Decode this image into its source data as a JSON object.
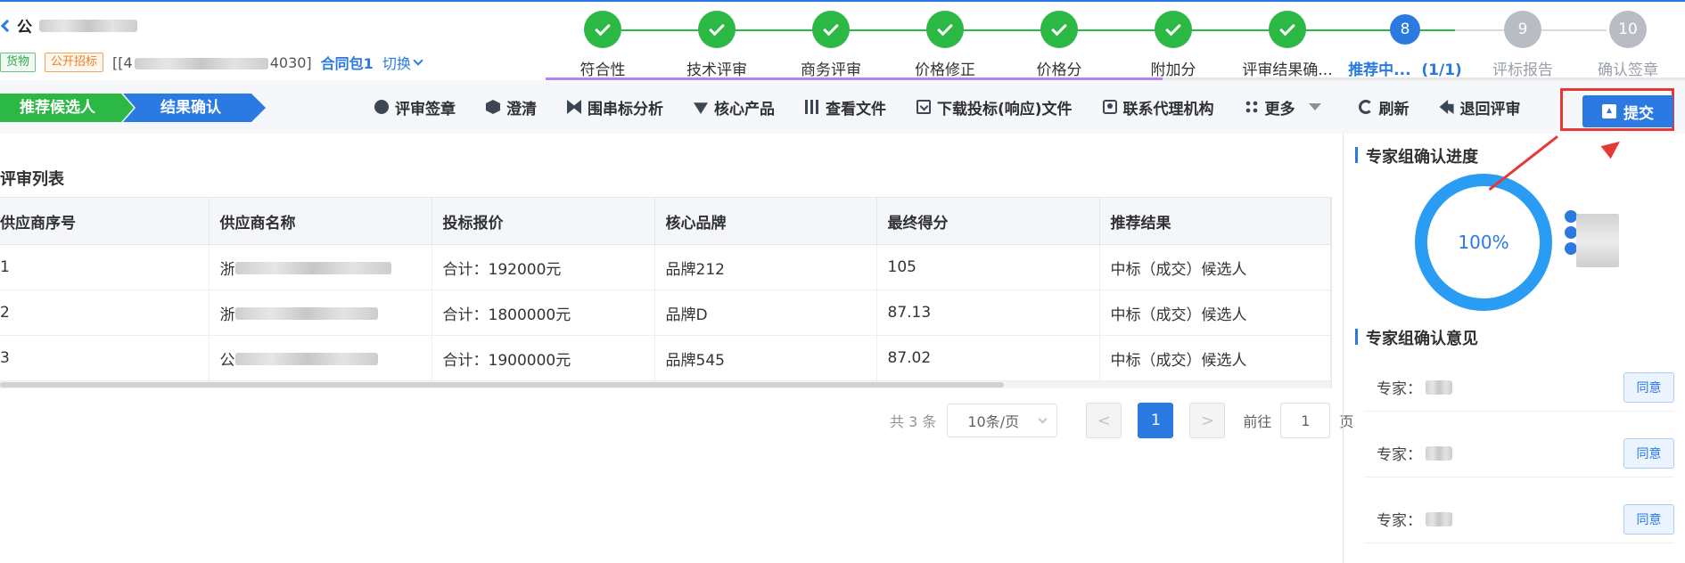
{
  "header": {
    "project_title": "公",
    "tags": [
      "货物",
      "公开招标"
    ],
    "project_code": "[[4",
    "project_code_tail": "4030]",
    "package": "合同包1",
    "switch_label": "切换"
  },
  "steps": [
    {
      "label": "符合性",
      "state": "done",
      "num": ""
    },
    {
      "label": "技术评审",
      "state": "done",
      "num": ""
    },
    {
      "label": "商务评审",
      "state": "done",
      "num": ""
    },
    {
      "label": "价格修正",
      "state": "done",
      "num": ""
    },
    {
      "label": "价格分",
      "state": "done",
      "num": ""
    },
    {
      "label": "附加分",
      "state": "done",
      "num": ""
    },
    {
      "label": "评审结果确...",
      "state": "done",
      "num": ""
    },
    {
      "label": "推荐中...",
      "state": "active",
      "num": "8",
      "progress": "(1/1)"
    },
    {
      "label": "评标报告",
      "state": "todo",
      "num": "9"
    },
    {
      "label": "确认签章",
      "state": "todo",
      "num": "10"
    }
  ],
  "breadcrumbs": [
    "推荐候选人",
    "结果确认"
  ],
  "toolbar": {
    "sign": "评审签章",
    "clarify": "澄清",
    "bid_analysis": "围串标分析",
    "core_product": "核心产品",
    "view_file": "查看文件",
    "download": "下载投标(响应)文件",
    "contact_agency": "联系代理机构",
    "more": "更多",
    "refresh": "刷新",
    "return": "退回评审",
    "submit": "提交"
  },
  "list": {
    "title": "评审列表",
    "columns": [
      "供应商序号",
      "供应商名称",
      "投标报价",
      "核心品牌",
      "最终得分",
      "推荐结果"
    ],
    "rows": [
      {
        "no": "1",
        "name_prefix": "浙",
        "price": "合计：192000元",
        "brand": "品牌212",
        "score": "105",
        "result": "中标（成交）候选人"
      },
      {
        "no": "2",
        "name_prefix": "浙",
        "price": "合计：1800000元",
        "brand": "品牌D",
        "score": "87.13",
        "result": "中标（成交）候选人"
      },
      {
        "no": "3",
        "name_prefix": "公",
        "price": "合计：1900000元",
        "brand": "品牌545",
        "score": "87.02",
        "result": "中标（成交）候选人"
      }
    ]
  },
  "pagination": {
    "total": "共 3 条",
    "page_size": "10条/页",
    "prev": "<",
    "current": "1",
    "next": ">",
    "goto_label": "前往",
    "goto_value": "1",
    "goto_unit": "页"
  },
  "progress_panel": {
    "title": "专家组确认进度",
    "percent": "100%"
  },
  "opinion_panel": {
    "title": "专家组确认意见",
    "items": [
      {
        "label": "专家：",
        "button": "同意"
      },
      {
        "label": "专家：",
        "button": "同意"
      },
      {
        "label": "专家：",
        "button": "同意"
      }
    ]
  }
}
